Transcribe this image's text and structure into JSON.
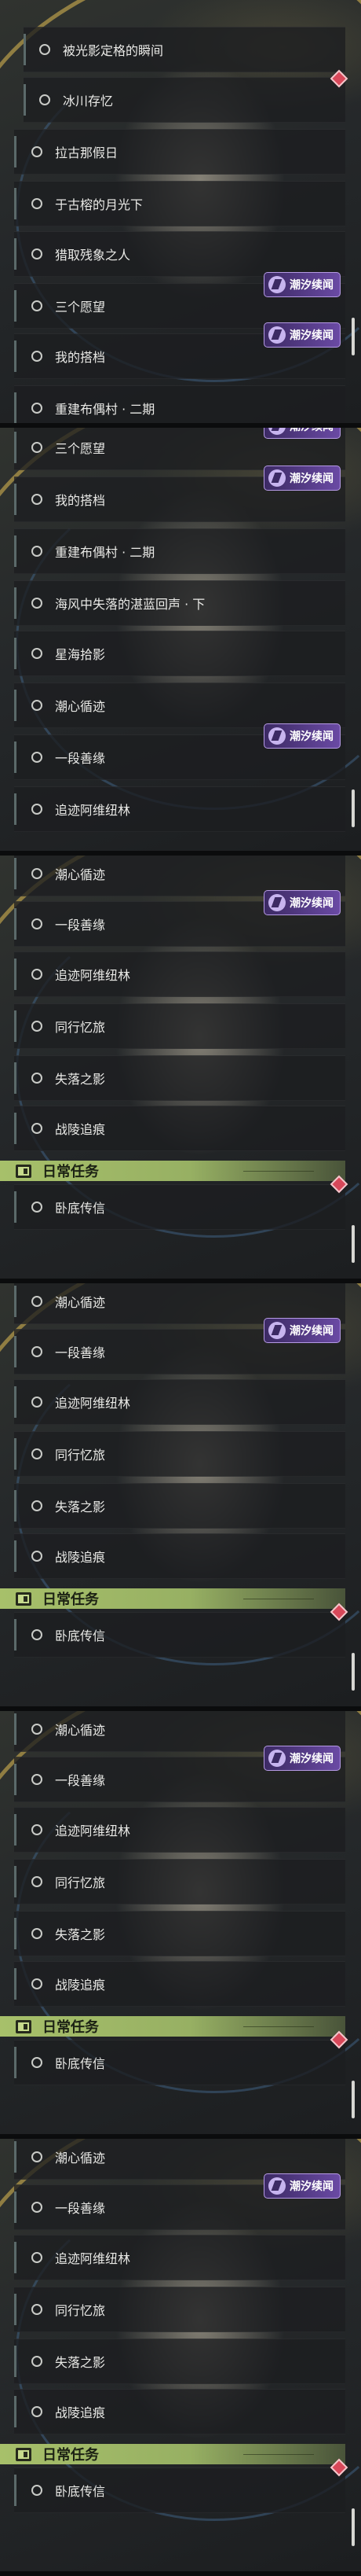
{
  "badge_text": "潮汐续闻",
  "daily_title": "日常任务",
  "panels": [
    {
      "rows": [
        {
          "label": "被光影定格的瞬间",
          "indent": true
        },
        {
          "label": "冰川存忆",
          "indent": true
        },
        {
          "label": "拉古那假日",
          "indent": false
        },
        {
          "label": "于古榕的月光下",
          "indent": false
        },
        {
          "label": "猎取残象之人",
          "indent": false
        },
        {
          "label": "三个愿望",
          "indent": false,
          "badge": true
        },
        {
          "label": "我的搭档",
          "indent": false,
          "badge": true
        },
        {
          "label": "重建布偶村 · 二期",
          "indent": false
        }
      ]
    },
    {
      "rows": [
        {
          "label": "三个愿望",
          "indent": false,
          "badge": true
        },
        {
          "label": "我的搭档",
          "indent": false,
          "badge": true
        },
        {
          "label": "重建布偶村 · 二期",
          "indent": false
        },
        {
          "label": "海风中失落的湛蓝回声 · 下",
          "indent": false
        },
        {
          "label": "星海拾影",
          "indent": false
        },
        {
          "label": "潮心循迹",
          "indent": false
        },
        {
          "label": "一段善缘",
          "indent": false,
          "badge": true
        },
        {
          "label": "追迹阿维纽林",
          "indent": false
        }
      ]
    },
    {
      "rows": [
        {
          "label": "潮心循迹",
          "indent": false
        },
        {
          "label": "一段善缘",
          "indent": false,
          "badge": true
        },
        {
          "label": "追迹阿维纽林",
          "indent": false
        },
        {
          "label": "同行忆旅",
          "indent": false
        },
        {
          "label": "失落之影",
          "indent": false
        },
        {
          "label": "战陵追痕",
          "indent": false
        }
      ],
      "daily": "卧底传信"
    },
    {
      "rows": [
        {
          "label": "潮心循迹",
          "indent": false
        },
        {
          "label": "一段善缘",
          "indent": false,
          "badge": true
        },
        {
          "label": "追迹阿维纽林",
          "indent": false
        },
        {
          "label": "同行忆旅",
          "indent": false
        },
        {
          "label": "失落之影",
          "indent": false
        },
        {
          "label": "战陵追痕",
          "indent": false
        }
      ],
      "daily": "卧底传信"
    },
    {
      "rows": [
        {
          "label": "潮心循迹",
          "indent": false
        },
        {
          "label": "一段善缘",
          "indent": false,
          "badge": true
        },
        {
          "label": "追迹阿维纽林",
          "indent": false
        },
        {
          "label": "同行忆旅",
          "indent": false
        },
        {
          "label": "失落之影",
          "indent": false
        },
        {
          "label": "战陵追痕",
          "indent": false
        }
      ],
      "daily": "卧底传信"
    },
    {
      "rows": [
        {
          "label": "潮心循迹",
          "indent": false
        },
        {
          "label": "一段善缘",
          "indent": false,
          "badge": true
        },
        {
          "label": "追迹阿维纽林",
          "indent": false
        },
        {
          "label": "同行忆旅",
          "indent": false
        },
        {
          "label": "失落之影",
          "indent": false
        },
        {
          "label": "战陵追痕",
          "indent": false
        }
      ],
      "daily": "卧底传信"
    }
  ]
}
